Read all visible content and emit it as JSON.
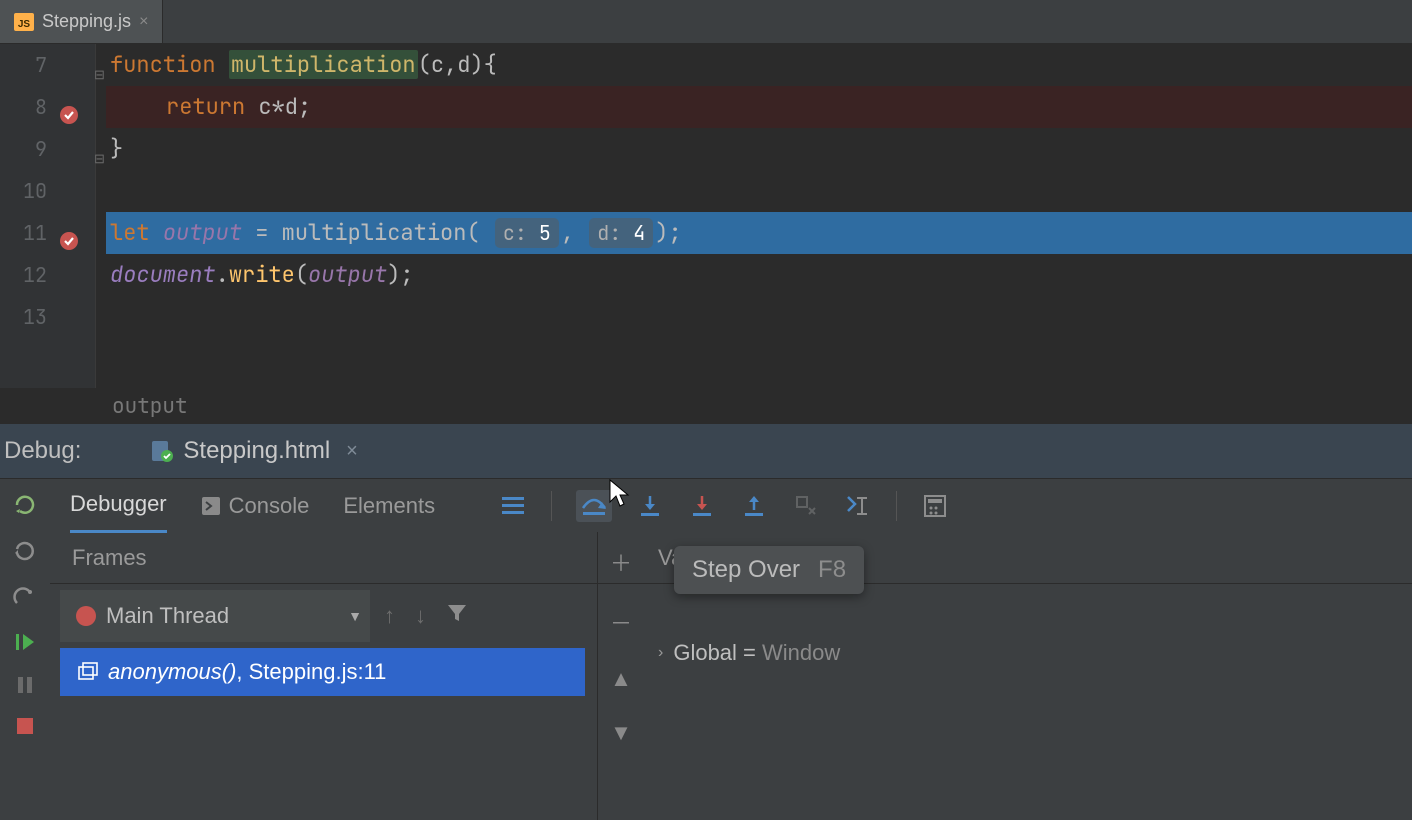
{
  "tabs": {
    "file": {
      "name": "Stepping.js",
      "ext": "JS"
    }
  },
  "editor": {
    "lines": [
      "7",
      "8",
      "9",
      "10",
      "11",
      "12",
      "13"
    ],
    "code": {
      "l7": {
        "kw": "function",
        "fn": "multiplication",
        "params": "(c,d){"
      },
      "l8": {
        "kw": "return",
        "body": " c*d;"
      },
      "l9": {
        "brace": "}"
      },
      "l11": {
        "kw": "let ",
        "ident": "output",
        "eq": " = ",
        "call": "multiplication",
        "hint1_k": "c:",
        "hint1_v": "5",
        "hint2_k": "d:",
        "hint2_v": "4",
        "tail": ");",
        "sep": ", "
      },
      "l12": {
        "obj": "document",
        "dot": ".",
        "method": "write",
        "args": "(",
        "ident": "output",
        "close": ");"
      }
    },
    "inline_hint": "output"
  },
  "debug": {
    "label": "Debug:",
    "config": "Stepping.html",
    "tabs": {
      "debugger": "Debugger",
      "console": "Console",
      "elements": "Elements"
    },
    "frames_title": "Frames",
    "vars_title": "Variables",
    "thread": "Main Thread",
    "frame": {
      "fn": "anonymous()",
      "loc": ", Stepping.js:11"
    },
    "vars": {
      "global_k": "Global",
      "global_eq": " = ",
      "global_v": "Window"
    },
    "tooltip": {
      "label": "Step Over",
      "key": "F8"
    }
  }
}
